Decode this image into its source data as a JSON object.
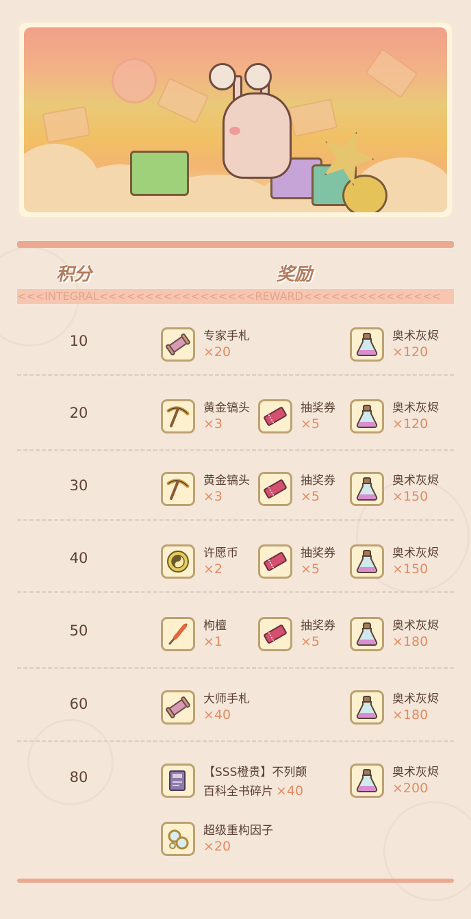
{
  "header": {
    "score_label": "积分",
    "reward_label": "奖励",
    "strip_text": "<<<INTEGRAL<<<<<<<<<<<<<<<<<REWARD<<<<<<<<<<<<<<<"
  },
  "rows": [
    {
      "score": "10",
      "items": [
        {
          "name": "专家手札",
          "qty": "×20",
          "icon": "scroll-icon"
        },
        {
          "name": "奥术灰烬",
          "qty": "×120",
          "icon": "potion-icon"
        }
      ]
    },
    {
      "score": "20",
      "items": [
        {
          "name": "黄金镐头",
          "qty": "×3",
          "icon": "pickaxe-icon"
        },
        {
          "name": "抽奖券",
          "qty": "×5",
          "icon": "ticket-icon"
        },
        {
          "name": "奥术灰烬",
          "qty": "×120",
          "icon": "potion-icon"
        }
      ]
    },
    {
      "score": "30",
      "items": [
        {
          "name": "黄金镐头",
          "qty": "×3",
          "icon": "pickaxe-icon"
        },
        {
          "name": "抽奖券",
          "qty": "×5",
          "icon": "ticket-icon"
        },
        {
          "name": "奥术灰烬",
          "qty": "×150",
          "icon": "potion-icon"
        }
      ]
    },
    {
      "score": "40",
      "items": [
        {
          "name": "许愿币",
          "qty": "×2",
          "icon": "coin-icon"
        },
        {
          "name": "抽奖券",
          "qty": "×5",
          "icon": "ticket-icon"
        },
        {
          "name": "奥术灰烬",
          "qty": "×150",
          "icon": "potion-icon"
        }
      ]
    },
    {
      "score": "50",
      "items": [
        {
          "name": "枸檀",
          "qty": "×1",
          "icon": "incense-icon"
        },
        {
          "name": "抽奖券",
          "qty": "×5",
          "icon": "ticket-icon"
        },
        {
          "name": "奥术灰烬",
          "qty": "×180",
          "icon": "potion-icon"
        }
      ]
    },
    {
      "score": "60",
      "items": [
        {
          "name": "大师手札",
          "qty": "×40",
          "icon": "scroll-icon"
        },
        {
          "name": "奥术灰烬",
          "qty": "×180",
          "icon": "potion-icon"
        }
      ]
    },
    {
      "score": "80",
      "items": [
        {
          "name": "【SSS橙贵】不列颠",
          "name2": "百科全书碎片",
          "qty": "×40",
          "icon": "book-fragment-icon"
        },
        {
          "name": "奥术灰烬",
          "qty": "×200",
          "icon": "potion-icon"
        },
        {
          "name": "超级重构因子",
          "qty": "×20",
          "icon": "factor-icon"
        }
      ]
    }
  ]
}
